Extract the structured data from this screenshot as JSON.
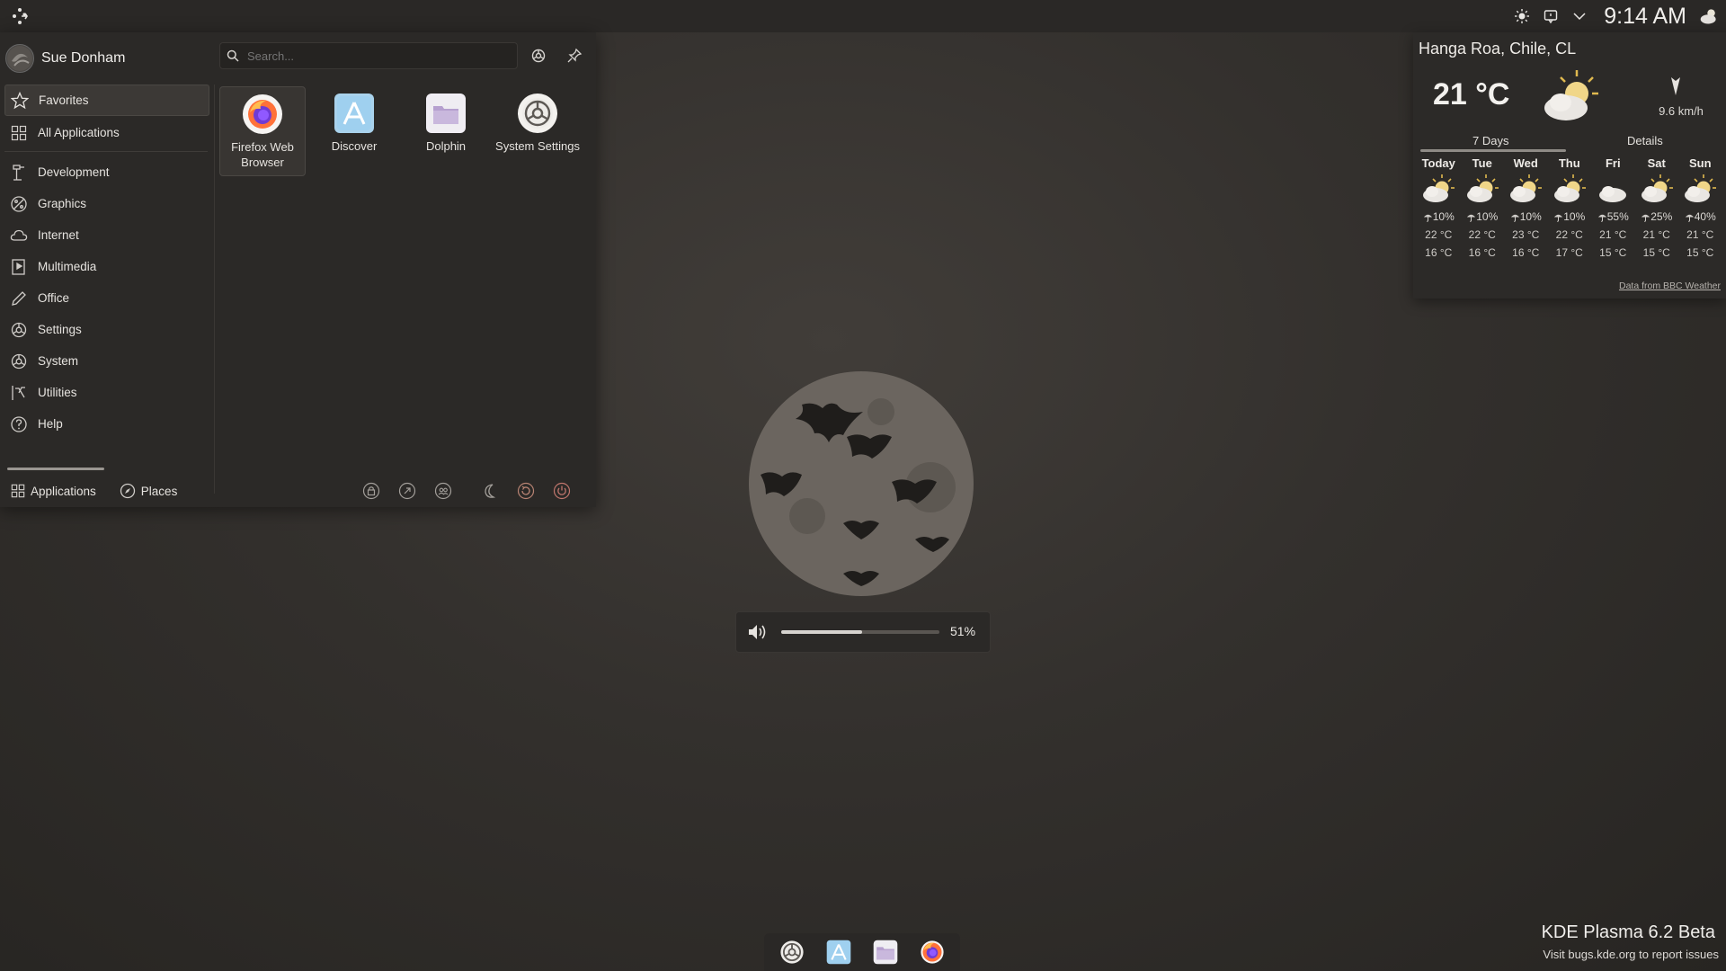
{
  "top_panel": {
    "clock": "9:14 AM",
    "tray_icons": [
      "brightness-icon",
      "notifications-icon",
      "chevron-down-icon",
      "weather-icon"
    ]
  },
  "launcher": {
    "user_name": "Sue Donham",
    "search_placeholder": "Search...",
    "categories": [
      {
        "label": "Favorites",
        "icon": "star-icon",
        "selected": true
      },
      {
        "label": "All Applications",
        "icon": "grid-icon"
      },
      {
        "label": "Development",
        "icon": "development-icon"
      },
      {
        "label": "Graphics",
        "icon": "graphics-icon"
      },
      {
        "label": "Internet",
        "icon": "cloud-icon"
      },
      {
        "label": "Multimedia",
        "icon": "multimedia-icon"
      },
      {
        "label": "Office",
        "icon": "pencil-icon"
      },
      {
        "label": "Settings",
        "icon": "settings-icon"
      },
      {
        "label": "System",
        "icon": "system-icon"
      },
      {
        "label": "Utilities",
        "icon": "utilities-icon"
      },
      {
        "label": "Help",
        "icon": "help-icon"
      }
    ],
    "apps": [
      {
        "name": "Firefox Web Browser",
        "icon": "firefox-icon"
      },
      {
        "name": "Discover",
        "icon": "discover-icon"
      },
      {
        "name": "Dolphin",
        "icon": "dolphin-icon"
      },
      {
        "name": "System Settings",
        "icon": "system-settings-icon"
      }
    ],
    "footer_tabs": [
      {
        "label": "Applications",
        "icon": "grid-icon"
      },
      {
        "label": "Places",
        "icon": "compass-icon"
      }
    ],
    "power_buttons": [
      "lock-icon",
      "logout-icon",
      "switch-user-icon",
      "sleep-icon",
      "restart-icon",
      "shutdown-icon"
    ]
  },
  "weather": {
    "location": "Hanga Roa, Chile, CL",
    "temperature": "21 °C",
    "wind": "9.6 km/h",
    "tabs": [
      "7 Days",
      "Details"
    ],
    "days": [
      {
        "name": "Today",
        "precip": "10%",
        "high": "22 °C",
        "low": "16 °C",
        "icon": "partly-cloudy-icon"
      },
      {
        "name": "Tue",
        "precip": "10%",
        "high": "22 °C",
        "low": "16 °C",
        "icon": "partly-cloudy-icon"
      },
      {
        "name": "Wed",
        "precip": "10%",
        "high": "23 °C",
        "low": "16 °C",
        "icon": "partly-cloudy-icon"
      },
      {
        "name": "Thu",
        "precip": "10%",
        "high": "22 °C",
        "low": "17 °C",
        "icon": "partly-cloudy-icon"
      },
      {
        "name": "Fri",
        "precip": "55%",
        "high": "21 °C",
        "low": "15 °C",
        "icon": "cloudy-icon"
      },
      {
        "name": "Sat",
        "precip": "25%",
        "high": "21 °C",
        "low": "15 °C",
        "icon": "partly-cloudy-icon"
      },
      {
        "name": "Sun",
        "precip": "40%",
        "high": "21 °C",
        "low": "15 °C",
        "icon": "partly-cloudy-icon"
      }
    ],
    "credit": "Data from BBC Weather"
  },
  "volume_osd": {
    "value_text": "51%",
    "level": 0.51
  },
  "dock": [
    "system-settings-icon",
    "discover-icon",
    "dolphin-icon",
    "firefox-icon"
  ],
  "branding": {
    "title": "KDE Plasma 6.2 Beta",
    "subtitle": "Visit bugs.kde.org to report issues"
  }
}
